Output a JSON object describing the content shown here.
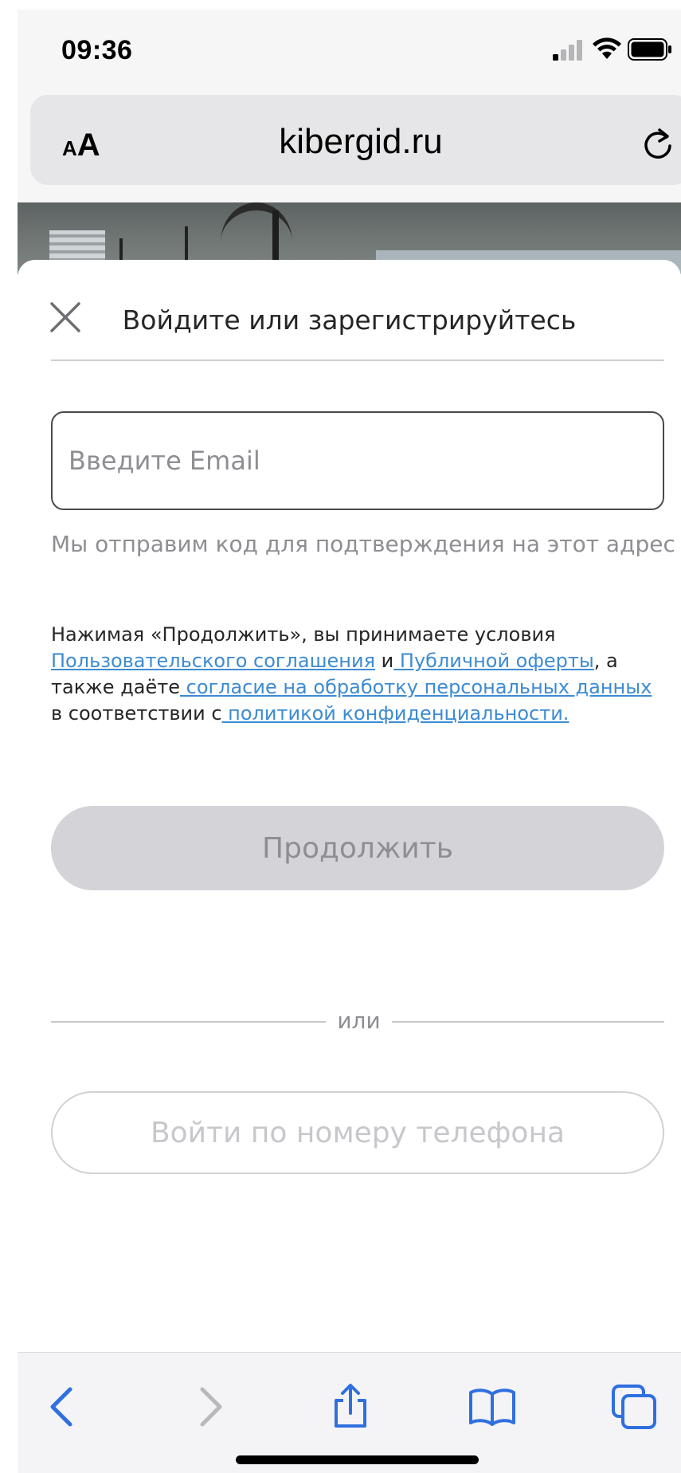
{
  "status_bar": {
    "time": "09:36"
  },
  "address_bar": {
    "aa_small": "A",
    "aa_big": "A",
    "url": "kibergid.ru"
  },
  "modal": {
    "title": "Войдите или зарегистрируйтесь",
    "email_placeholder": "Введите Email",
    "hint": "Мы отправим код для подтверждения на этот адрес",
    "terms": {
      "part1": "Нажимая «Продолжить», вы принимаете условия",
      "link_agreement": "Пользовательского соглашения",
      "part2": " и",
      "link_offer": " Публичной оферты",
      "part3": ", а также даёте",
      "link_consent": " согласие на обработку персональных данных",
      "part4": "в соответствии с",
      "link_policy": " политикой конфиденциальности."
    },
    "continue_label": "Продолжить",
    "or_label": "или",
    "phone_login_label": "Войти по номеру телефона"
  },
  "toolbar": {
    "icons": [
      "back-icon",
      "forward-icon",
      "share-icon",
      "bookmarks-icon",
      "tabs-icon"
    ]
  },
  "colors": {
    "link": "#3d8bd2",
    "accent_blue": "#2f6fe0",
    "disabled_button": "#d3d3d8"
  }
}
